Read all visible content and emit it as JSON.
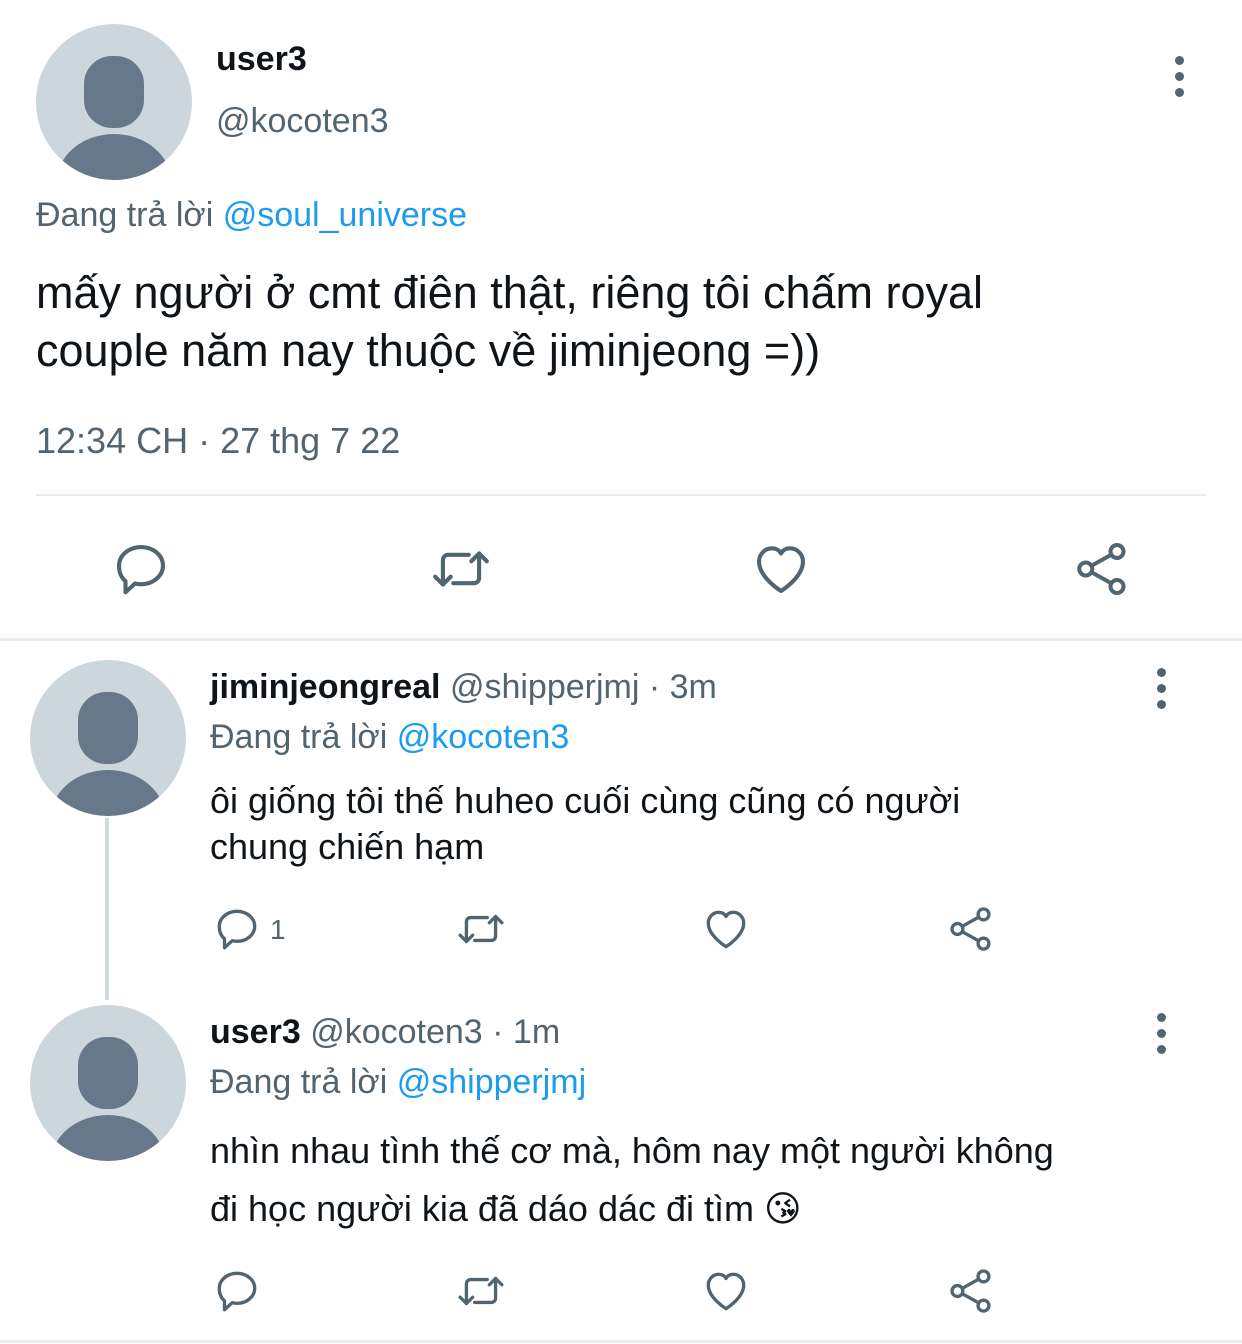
{
  "main_tweet": {
    "name": "user3",
    "handle": "@kocoten3",
    "replying_prefix": "Đang trả lời",
    "replying_to": "@soul_universe",
    "text_line1": "mấy người ở cmt điên thật, riêng tôi chấm royal",
    "text_line2": "couple năm nay thuộc về jiminjeong =))",
    "timestamp": "12:34 CH · 27 thg 7 22"
  },
  "replies": [
    {
      "name": "jiminjeongreal",
      "handle": "@shipperjmj",
      "time": "· 3m",
      "replying_prefix": "Đang trả lời",
      "replying_to": "@kocoten3",
      "text_line1": "ôi giống tôi thế huheo cuối cùng cũng có người",
      "text_line2": "chung chiến hạm",
      "reply_count": "1"
    },
    {
      "name": "user3",
      "handle": "@kocoten3",
      "time": "· 1m",
      "replying_prefix": "Đang trả lời",
      "replying_to": "@shipperjmj",
      "text_line1": "nhìn nhau tình thế cơ mà, hôm nay một người không",
      "text_line2": "đi học người kia đã dáo dác đi tìm 😘"
    }
  ],
  "colors": {
    "accent": "#1d9bf0",
    "muted_text": "#536471",
    "avatar_bg": "#ccd6dd",
    "avatar_fg": "#66788a",
    "divider": "#e6ecf0"
  },
  "icons": [
    "reply-icon",
    "retweet-icon",
    "like-icon",
    "share-icon",
    "more-icon",
    "avatar-placeholder-icon"
  ]
}
